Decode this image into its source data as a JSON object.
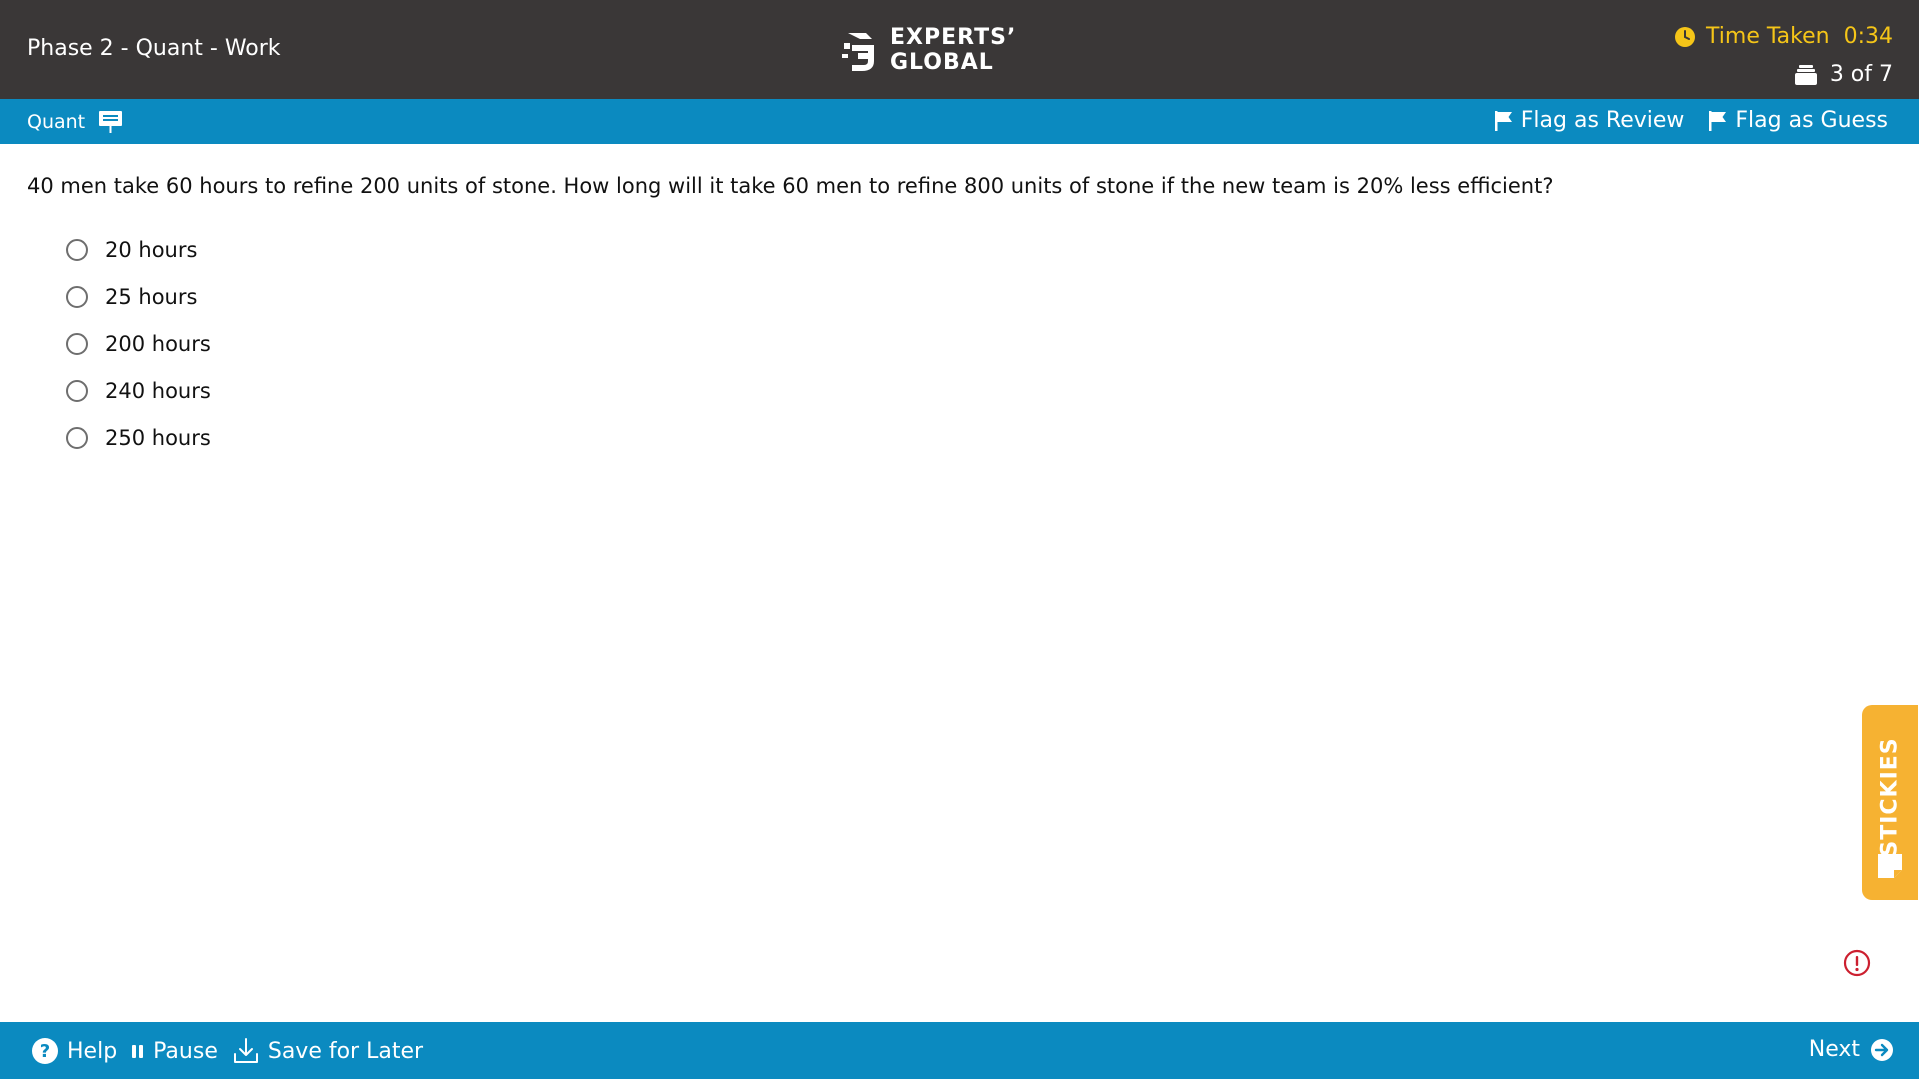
{
  "header": {
    "section_title": "Phase 2 - Quant - Work",
    "logo_line1": "EXPERTS’",
    "logo_line2": "GLOBAL",
    "timer_label": "Time Taken",
    "timer_value": "0:34",
    "progress": "3 of 7"
  },
  "subbar": {
    "section_label": "Quant",
    "flag_review": "Flag as Review",
    "flag_guess": "Flag as Guess"
  },
  "question": {
    "text": "40 men take 60 hours to refine 200 units of stone. How long will it take 60 men to refine 800 units of stone if the new team is 20% less efficient?",
    "options": [
      "20 hours",
      "25 hours",
      "200 hours",
      "240 hours",
      "250 hours"
    ]
  },
  "stickies": {
    "label": "STICKIES"
  },
  "footer": {
    "help": "Help",
    "pause": "Pause",
    "save": "Save for Later",
    "next": "Next"
  },
  "colors": {
    "header_bg": "#3a3737",
    "accent_blue": "#0b8ac0",
    "timer_yellow": "#f5c518",
    "stickies_orange": "#f6b232",
    "alert_red": "#cc1f2f"
  }
}
